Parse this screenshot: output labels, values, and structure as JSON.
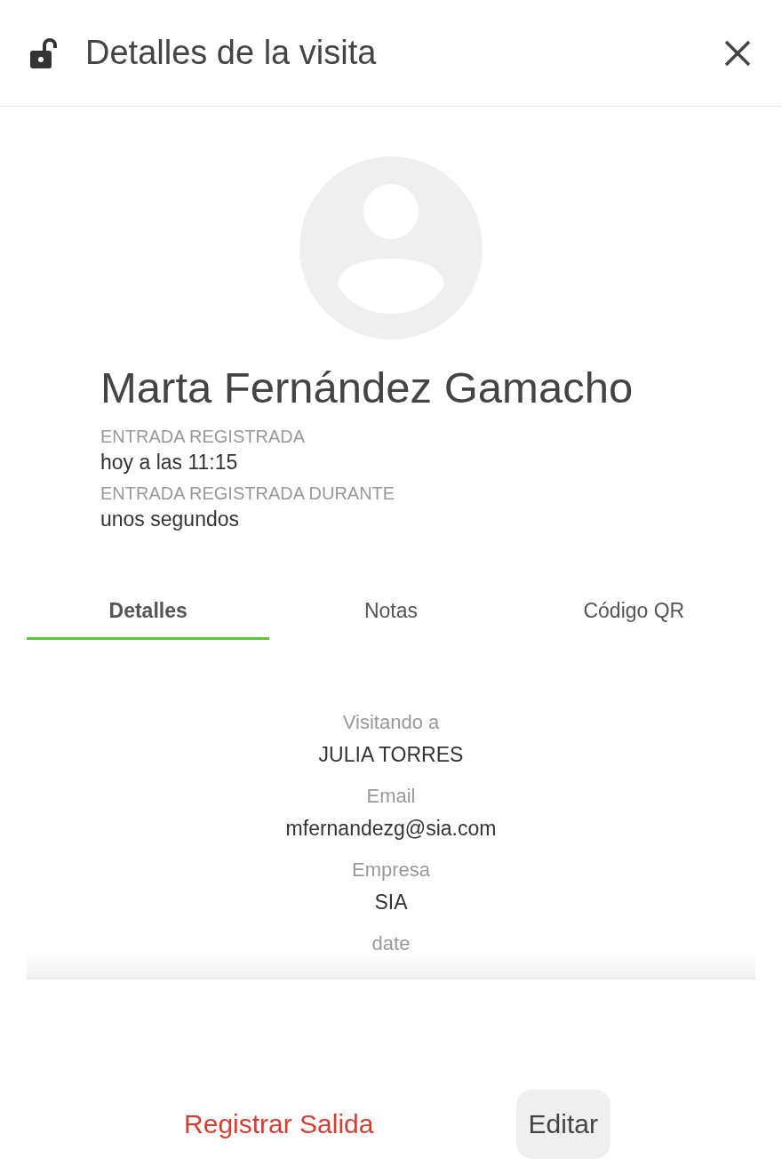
{
  "header": {
    "title": "Detalles de la visita",
    "locked": false
  },
  "visitor": {
    "name": "Marta Fernández Gamacho",
    "facts": [
      {
        "label": "ENTRADA REGISTRADA",
        "value": "hoy a las 11:15"
      },
      {
        "label": "ENTRADA REGISTRADA DURANTE",
        "value": "unos segundos"
      }
    ]
  },
  "tabs": [
    {
      "label": "Detalles",
      "selected": true
    },
    {
      "label": "Notas",
      "selected": false
    },
    {
      "label": "Código QR",
      "selected": false
    }
  ],
  "details": [
    {
      "label": "Visitando a",
      "value": "JULIA TORRES"
    },
    {
      "label": "Email",
      "value": "mfernandezg@sia.com"
    },
    {
      "label": "Empresa",
      "value": "SIA"
    },
    {
      "label": "date"
    }
  ],
  "actions": [
    {
      "kind": "danger",
      "label": "Registrar Salida"
    },
    {
      "kind": "secondary",
      "label": "Editar"
    }
  ]
}
